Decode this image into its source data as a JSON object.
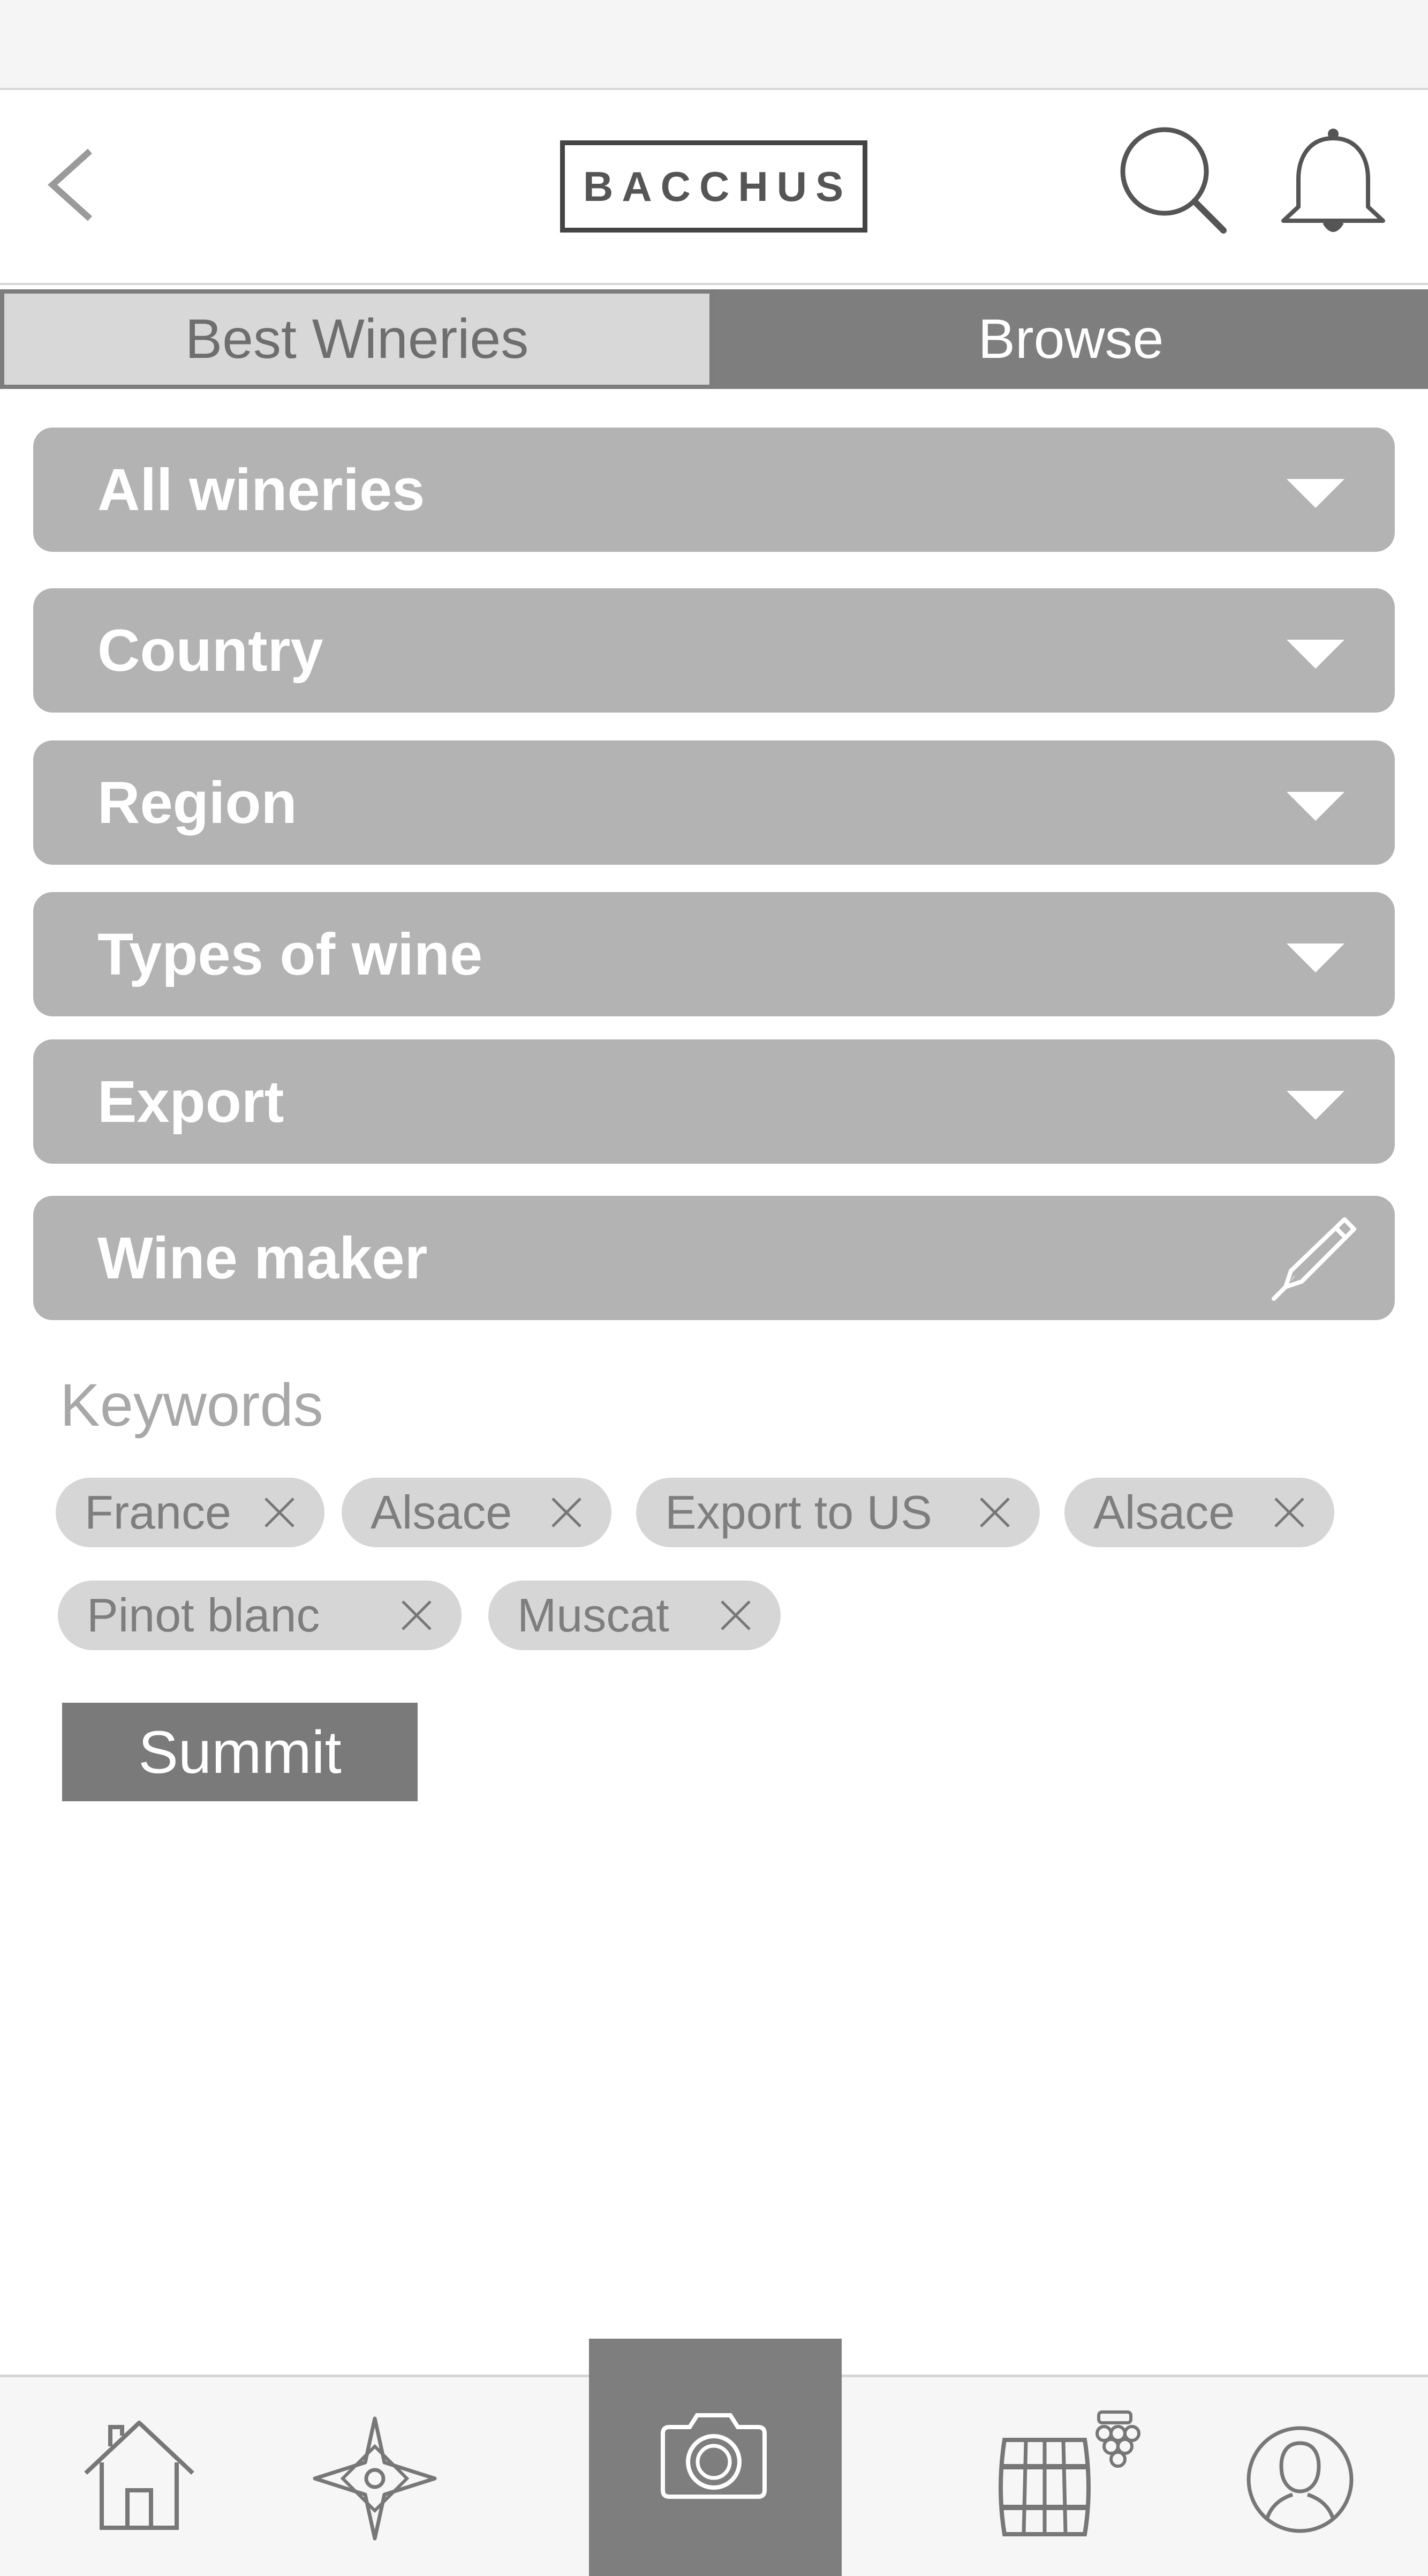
{
  "header": {
    "logo_text": "BACCHUS",
    "back_icon": "chevron-left-icon",
    "search_icon": "search-icon",
    "notification_icon": "bell-icon"
  },
  "tabs": [
    {
      "label": "Best Wineries",
      "selected": true
    },
    {
      "label": "Browse",
      "selected": false
    }
  ],
  "filters": [
    {
      "label": "All wineries",
      "icon": "chevron-down-icon"
    },
    {
      "label": "Country",
      "icon": "chevron-down-icon"
    },
    {
      "label": "Region",
      "icon": "chevron-down-icon"
    },
    {
      "label": "Types of wine",
      "icon": "chevron-down-icon"
    },
    {
      "label": "Export",
      "icon": "chevron-down-icon"
    },
    {
      "label": "Wine maker",
      "icon": "pen-icon"
    }
  ],
  "keywords": {
    "title": "Keywords",
    "chips": [
      {
        "label": "France"
      },
      {
        "label": "Alsace"
      },
      {
        "label": "Export to US"
      },
      {
        "label": "Alsace"
      },
      {
        "label": "Pinot blanc"
      },
      {
        "label": "Muscat"
      }
    ]
  },
  "submit_label": "Summit",
  "nav": [
    {
      "name": "home",
      "icon": "home-icon"
    },
    {
      "name": "explore",
      "icon": "compass-icon"
    },
    {
      "name": "camera",
      "icon": "camera-icon"
    },
    {
      "name": "cellar",
      "icon": "barrel-icon"
    },
    {
      "name": "profile",
      "icon": "user-icon"
    }
  ],
  "colors": {
    "filter_bar": "#b3b3b3",
    "active_tab": "#7e7e7e",
    "chip": "#d6d6d6",
    "button": "#7a7a7a"
  }
}
